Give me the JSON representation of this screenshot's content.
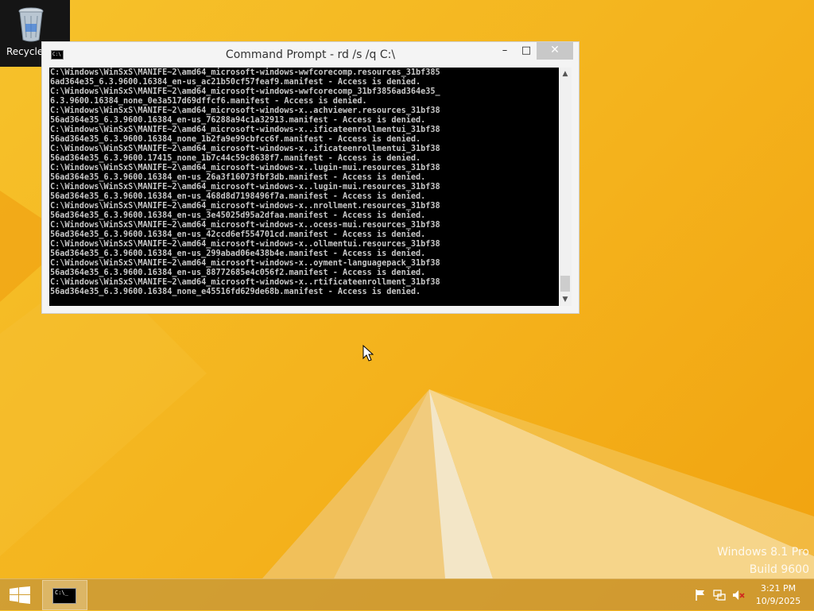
{
  "desktop": {
    "recycle_bin_label": "Recycle"
  },
  "window": {
    "title": "Command Prompt - rd  /s /q C:\\",
    "minimize_glyph": "–",
    "maximize_glyph": "□",
    "close_glyph": "✕",
    "console_lines": [
      "C:\\Windows\\WinSxS\\MANIFE~2\\amd64_microsoft-windows-wwfcorecomp.resources_31bf385",
      "6ad364e35_6.3.9600.16384_en-us_ac21b50cf57feaf9.manifest - Access is denied.",
      "C:\\Windows\\WinSxS\\MANIFE~2\\amd64_microsoft-windows-wwfcorecomp_31bf3856ad364e35_",
      "6.3.9600.16384_none_0e3a517d69dffcf6.manifest - Access is denied.",
      "C:\\Windows\\WinSxS\\MANIFE~2\\amd64_microsoft-windows-x..achviewer.resources_31bf38",
      "56ad364e35_6.3.9600.16384_en-us_76288a94c1a32913.manifest - Access is denied.",
      "C:\\Windows\\WinSxS\\MANIFE~2\\amd64_microsoft-windows-x..ificateenrollmentui_31bf38",
      "56ad364e35_6.3.9600.16384_none_1b2fa9e99cbfcc6f.manifest - Access is denied.",
      "C:\\Windows\\WinSxS\\MANIFE~2\\amd64_microsoft-windows-x..ificateenrollmentui_31bf38",
      "56ad364e35_6.3.9600.17415_none_1b7c44c59c8638f7.manifest - Access is denied.",
      "C:\\Windows\\WinSxS\\MANIFE~2\\amd64_microsoft-windows-x..lugin-mui.resources_31bf38",
      "56ad364e35_6.3.9600.16384_en-us_26a3f16073fbf3db.manifest - Access is denied.",
      "C:\\Windows\\WinSxS\\MANIFE~2\\amd64_microsoft-windows-x..lugin-mui.resources_31bf38",
      "56ad364e35_6.3.9600.16384_en-us_468d8d7198496f7a.manifest - Access is denied.",
      "C:\\Windows\\WinSxS\\MANIFE~2\\amd64_microsoft-windows-x..nrollment.resources_31bf38",
      "56ad364e35_6.3.9600.16384_en-us_3e45025d95a2dfaa.manifest - Access is denied.",
      "C:\\Windows\\WinSxS\\MANIFE~2\\amd64_microsoft-windows-x..ocess-mui.resources_31bf38",
      "56ad364e35_6.3.9600.16384_en-us_42ccd6ef554701cd.manifest - Access is denied.",
      "C:\\Windows\\WinSxS\\MANIFE~2\\amd64_microsoft-windows-x..ollmentui.resources_31bf38",
      "56ad364e35_6.3.9600.16384_en-us_299abad06e438b4e.manifest - Access is denied.",
      "C:\\Windows\\WinSxS\\MANIFE~2\\amd64_microsoft-windows-x..oyment-languagepack_31bf38",
      "56ad364e35_6.3.9600.16384_en-us_88772685e4c056f2.manifest - Access is denied.",
      "C:\\Windows\\WinSxS\\MANIFE~2\\amd64_microsoft-windows-x..rtificateenrollment_31bf38",
      "56ad364e35_6.3.9600.16384_none_e45516fd629de68b.manifest - Access is denied."
    ]
  },
  "watermark": {
    "line1": "Windows 8.1 Pro",
    "line2": "Build 9600"
  },
  "taskbar": {
    "clock_time": "3:21 PM",
    "clock_date": "10/9/2025",
    "console_icon_text": "C:\\_"
  },
  "colors": {
    "wallpaper_primary": "#f4b21c",
    "console_bg": "#000000",
    "console_text": "#c8c8c8"
  }
}
